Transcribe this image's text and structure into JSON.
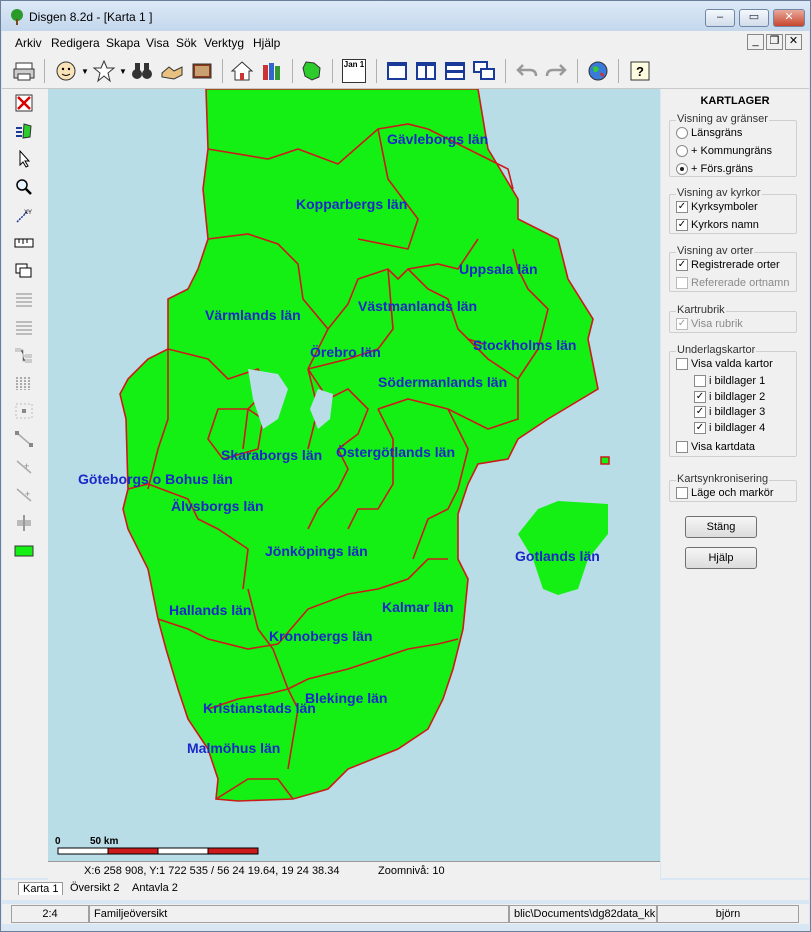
{
  "window": {
    "title": "Disgen 8.2d - [Karta 1 ]"
  },
  "menu": [
    "Arkiv",
    "Redigera",
    "Skapa",
    "Visa",
    "Sök",
    "Verktyg",
    "Hjälp"
  ],
  "icons": {
    "toolbar": [
      "print-icon",
      "person-icon",
      "person-star-icon",
      "binoculars-icon",
      "handshake-icon",
      "book-icon",
      "house-icon",
      "books-icon",
      "map-icon",
      "calendar-icon",
      "layout-single-icon",
      "layout-two-icon",
      "layout-rows-icon",
      "layout-cascade-icon",
      "undo-icon",
      "redo-icon",
      "globe-icon",
      "help-icon"
    ],
    "left": [
      "close-map-icon",
      "map-export-icon",
      "pointer-icon",
      "zoom-icon",
      "coordinate-icon",
      "ruler-icon",
      "copy-icon"
    ]
  },
  "toolbar_calendar_text": "Jan 1",
  "map": {
    "counties": [
      "Gävleborgs län",
      "Kopparbergs län",
      "Uppsala län",
      "Värmlands län",
      "Västmanlands län",
      "Stockholms län",
      "Örebro län",
      "Södermanlands län",
      "Skaraborgs län",
      "Östergötlands län",
      "Göteborgs o Bohus län",
      "Älvsborgs län",
      "Jönköpings län",
      "Gotlands län",
      "Hallands län",
      "Kalmar län",
      "Kronobergs län",
      "Blekinge län",
      "Kristianstads län",
      "Malmöhus län"
    ],
    "scale": {
      "zero": "0",
      "label": "50 km"
    },
    "colors": {
      "land": "#14f014",
      "water": "#b9dde6",
      "border": "#cc1a1a",
      "label": "#1a28c8"
    }
  },
  "coord": {
    "position": "X:6 258 908, Y:1 722 535 / 56 24 19.64, 19 24 38.34",
    "zoom": "Zoomnivå: 10"
  },
  "tabs": [
    "Karta 1",
    "Översikt 2",
    "Antavla 2"
  ],
  "status": {
    "pos": "2:4",
    "view": "Familjeöversikt",
    "path": "blic\\Documents\\dg82data_kk",
    "user": "björn"
  },
  "panel": {
    "title": "KARTLAGER",
    "borders": {
      "title": "Visning av gränser",
      "options": [
        "Länsgräns",
        "+ Kommungräns",
        "+ Förs.gräns"
      ],
      "selected": 2
    },
    "churches": {
      "title": "Visning av kyrkor",
      "symbols": "Kyrksymboler",
      "names": "Kyrkors namn"
    },
    "places": {
      "title": "Visning av orter",
      "registered": "Registrerade orter",
      "referenced": "Refererade ortnamn"
    },
    "heading": {
      "title": "Kartrubrik",
      "show": "Visa rubrik"
    },
    "base": {
      "title": "Underlagskartor",
      "show_selected": "Visa valda kartor",
      "layers": [
        "i bildlager 1",
        "i bildlager 2",
        "i bildlager 3",
        "i bildlager 4"
      ],
      "layers_checked": [
        false,
        true,
        true,
        true
      ],
      "show_data": "Visa kartdata"
    },
    "sync": {
      "title": "Kartsynkronisering",
      "option": "Läge och markör"
    },
    "close": "Stäng",
    "help": "Hjälp"
  }
}
